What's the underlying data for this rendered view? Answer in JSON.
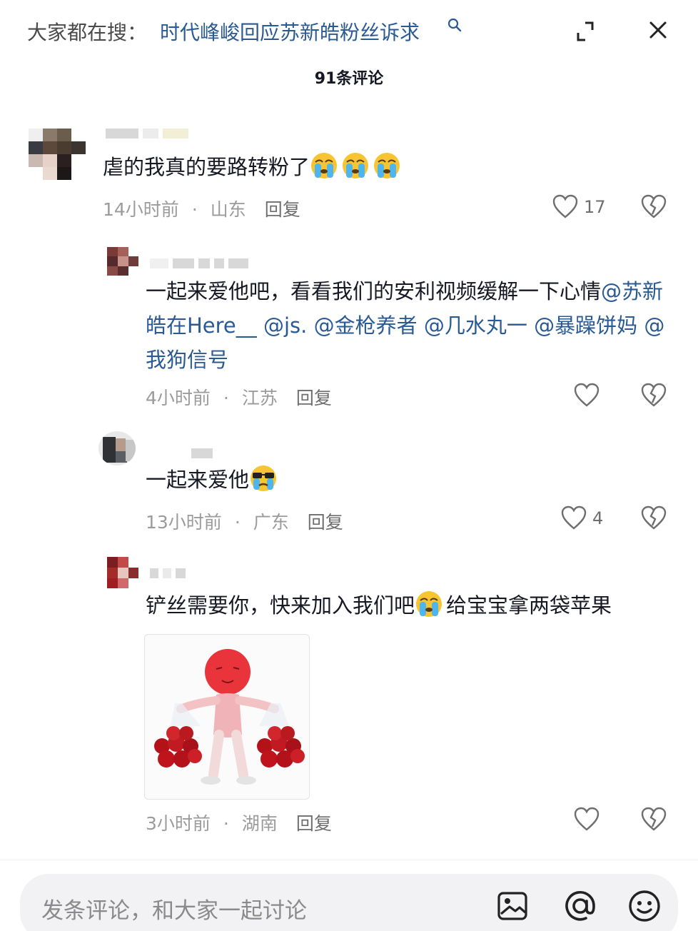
{
  "top": {
    "search_prefix": "大家都在搜：",
    "search_query": "时代峰峻回应苏新皓粉丝诉求",
    "search_icon": "search-icon",
    "expand_icon": "expand-icon",
    "close_icon": "close-icon"
  },
  "comment_count": "91条评论",
  "comments": [
    {
      "text": "虐的我真的要路转粉了",
      "emojis": [
        "crying-emoji",
        "crying-emoji",
        "crying-emoji"
      ],
      "time": "14小时前",
      "location": "山东",
      "reply": "回复",
      "likes": "17"
    },
    {
      "text_plain": "一起来爱他吧，看看我们的安利视频缓解一下心情",
      "mentions": [
        "@苏新皓在Here__",
        "@js.",
        "@金枪养者",
        "@几水丸一",
        "@暴躁饼妈",
        "@我狗信号"
      ],
      "time": "4小时前",
      "location": "江苏",
      "reply": "回复",
      "likes": ""
    },
    {
      "text": "一起来爱他",
      "emojis": [
        "cool-crying-emoji"
      ],
      "time": "13小时前",
      "location": "广东",
      "reply": "回复",
      "likes": "4"
    },
    {
      "text_before": "铲丝需要你，快来加入我们吧",
      "emojis": [
        "crying-emoji"
      ],
      "text_after": "给宝宝拿两袋苹果",
      "image": "red-stickman-holding-apple-bags",
      "time": "3小时前",
      "location": "湖南",
      "reply": "回复",
      "likes": ""
    }
  ],
  "input": {
    "placeholder": "发条评论，和大家一起讨论",
    "icons": [
      "image-icon",
      "at-icon",
      "emoji-icon"
    ]
  },
  "colors": {
    "link": "#2a5a94",
    "meta": "#9b9b9b",
    "text": "#161823",
    "input_bg": "#f2f2f4"
  }
}
